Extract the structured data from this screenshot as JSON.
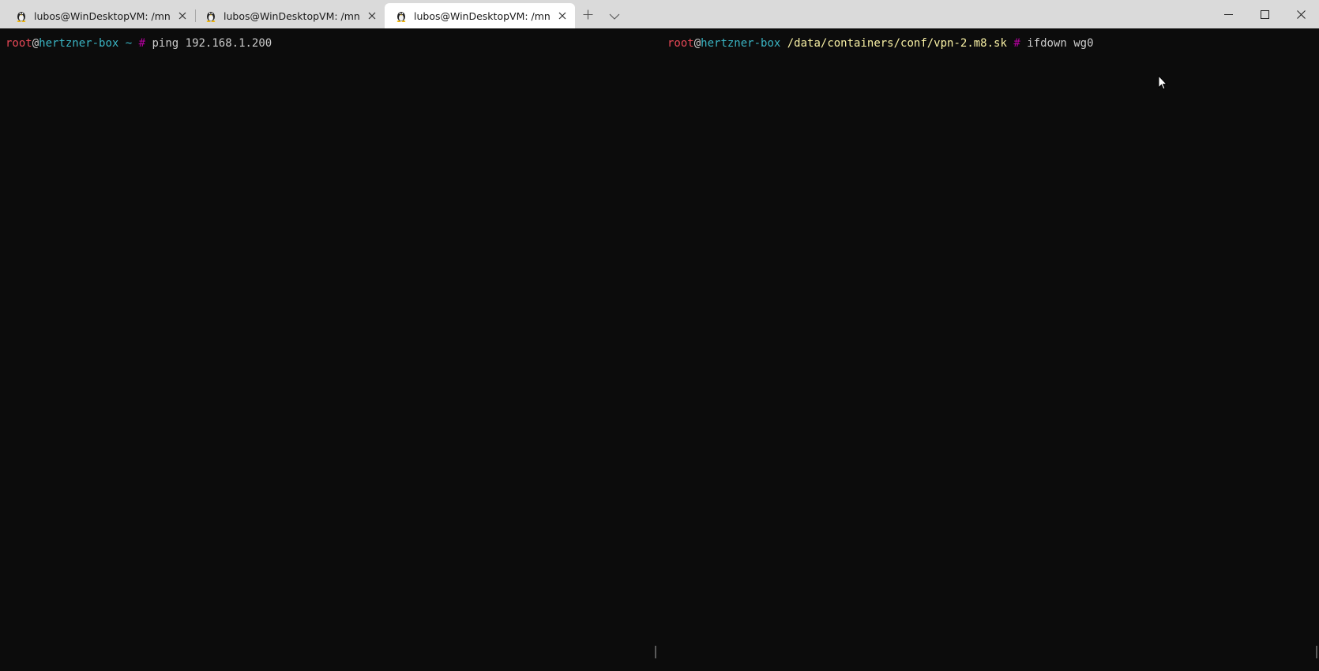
{
  "tabs": [
    {
      "title": "lubos@WinDesktopVM: /mnt/c/",
      "icon": "linux-tux-icon",
      "active": false
    },
    {
      "title": "lubos@WinDesktopVM: /mnt/d,",
      "icon": "linux-tux-icon",
      "active": false
    },
    {
      "title": "lubos@WinDesktopVM: /mnt/c/",
      "icon": "linux-tux-icon",
      "active": true
    }
  ],
  "toolbar": {
    "new_tab_icon": "plus-icon",
    "dropdown_icon": "chevron-down-icon"
  },
  "window_controls": {
    "minimize_icon": "minimize-icon",
    "maximize_icon": "maximize-icon",
    "close_icon": "close-icon"
  },
  "left_pane": {
    "user": "root",
    "at": "@",
    "host": "hertzner-box",
    "path": "~",
    "hash": "#",
    "command": "ping 192.168.1.200"
  },
  "right_pane": {
    "user": "root",
    "at": "@",
    "host": "hertzner-box",
    "path": "/data/containers/conf/vpn-2.m8.sk",
    "hash": "#",
    "command": "ifdown wg0"
  },
  "colors": {
    "terminal_bg": "#0c0c0c",
    "user": "#e74856",
    "host": "#3ab5c4",
    "path": "#f9f1a5",
    "hash": "#b4009e",
    "focus_divider": "#2a7fd4"
  }
}
